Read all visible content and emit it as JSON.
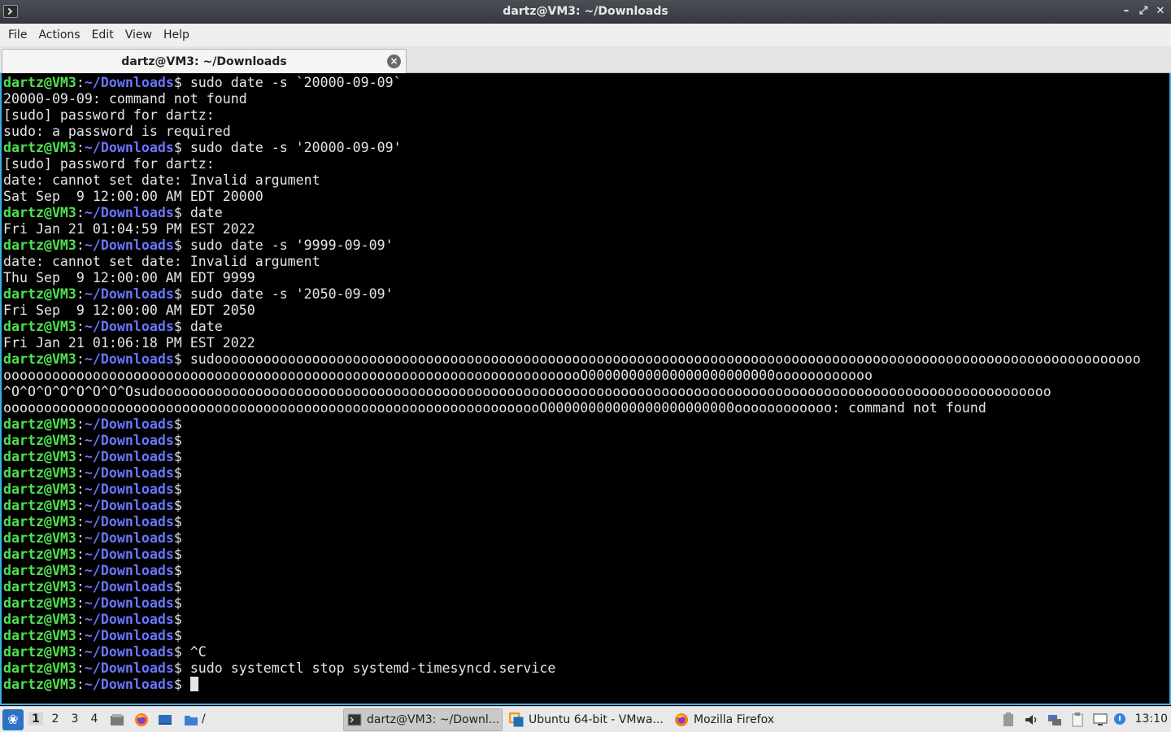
{
  "window": {
    "title": "dartz@VM3: ~/Downloads"
  },
  "menubar": {
    "items": [
      "File",
      "Actions",
      "Edit",
      "View",
      "Help"
    ]
  },
  "tabs": [
    {
      "label": "dartz@VM3: ~/Downloads",
      "active": true
    }
  ],
  "terminal": {
    "prompt": {
      "user_host": "dartz@VM3",
      "colon": ":",
      "path": "~/Downloads",
      "dollar": "$"
    },
    "lines": [
      {
        "type": "prompt",
        "text": " sudo date -s `20000-09-09`"
      },
      {
        "type": "output",
        "text": "20000-09-09: command not found"
      },
      {
        "type": "output",
        "text": "[sudo] password for dartz:"
      },
      {
        "type": "output",
        "text": "sudo: a password is required"
      },
      {
        "type": "prompt",
        "text": " sudo date -s '20000-09-09'"
      },
      {
        "type": "output",
        "text": "[sudo] password for dartz:"
      },
      {
        "type": "output",
        "text": "date: cannot set date: Invalid argument"
      },
      {
        "type": "output",
        "text": "Sat Sep  9 12:00:00 AM EDT 20000"
      },
      {
        "type": "prompt",
        "text": " date"
      },
      {
        "type": "output",
        "text": "Fri Jan 21 01:04:59 PM EST 2022"
      },
      {
        "type": "prompt",
        "text": " sudo date -s '9999-09-09'"
      },
      {
        "type": "output",
        "text": "date: cannot set date: Invalid argument"
      },
      {
        "type": "output",
        "text": "Thu Sep  9 12:00:00 AM EDT 9999"
      },
      {
        "type": "prompt",
        "text": " sudo date -s '2050-09-09'"
      },
      {
        "type": "output",
        "text": "Fri Sep  9 12:00:00 AM EDT 2050"
      },
      {
        "type": "prompt",
        "text": " date"
      },
      {
        "type": "output",
        "text": "Fri Jan 21 01:06:18 PM EST 2022"
      },
      {
        "type": "prompt",
        "text": " sudoooooooooooooooooooooooooooooooooooooooooooooooooooooooooooooooooooooooooooooooooooooooooooooooooooooooooooooooooo"
      },
      {
        "type": "output",
        "text": "oooooooooooooooooooooooooooooooooooooooooooooooooooooooooooooooooooooooO00000000000000000000000oooooooooooo"
      },
      {
        "type": "output",
        "text": "^O^O^O^O^O^O^O^Osudoooooooooooooooooooooooooooooooooooooooooooooooooooooooooooooooooooooooooooooooooooooooooooooooooooooooooooooo"
      },
      {
        "type": "output",
        "text": "ooooooooooooooooooooooooooooooooooooooooooooooooooooooooooooooooooO00000000000000000000000oooooooooooo: command not found"
      },
      {
        "type": "prompt",
        "text": ""
      },
      {
        "type": "prompt",
        "text": ""
      },
      {
        "type": "prompt",
        "text": ""
      },
      {
        "type": "prompt",
        "text": ""
      },
      {
        "type": "prompt",
        "text": ""
      },
      {
        "type": "prompt",
        "text": ""
      },
      {
        "type": "prompt",
        "text": ""
      },
      {
        "type": "prompt",
        "text": ""
      },
      {
        "type": "prompt",
        "text": ""
      },
      {
        "type": "prompt",
        "text": ""
      },
      {
        "type": "prompt",
        "text": ""
      },
      {
        "type": "prompt",
        "text": ""
      },
      {
        "type": "prompt",
        "text": ""
      },
      {
        "type": "prompt",
        "text": ""
      },
      {
        "type": "prompt",
        "text": " ^C"
      },
      {
        "type": "prompt",
        "text": " sudo systemctl stop systemd-timesyncd.service"
      },
      {
        "type": "prompt",
        "text": " ",
        "cursor": true
      }
    ]
  },
  "taskbar": {
    "workspaces": [
      "1",
      "2",
      "3",
      "4"
    ],
    "active_workspace": "1",
    "quicklaunch": [
      "file-manager-icon",
      "firefox-icon",
      "desktop-icon",
      "folder-icon"
    ],
    "path_label": "/",
    "tasks": [
      {
        "label": "dartz@VM3: ~/Downl...",
        "icon": "terminal-icon",
        "active": true
      },
      {
        "label": "Ubuntu 64-bit - VMwa...",
        "icon": "vmware-icon",
        "active": false
      },
      {
        "label": "Mozilla Firefox",
        "icon": "firefox-icon",
        "active": false
      }
    ],
    "tray": [
      "battery-icon",
      "volume-icon",
      "network-icon",
      "clipboard-icon",
      "display-icon",
      "notification-icon"
    ],
    "clock": "13:10"
  }
}
